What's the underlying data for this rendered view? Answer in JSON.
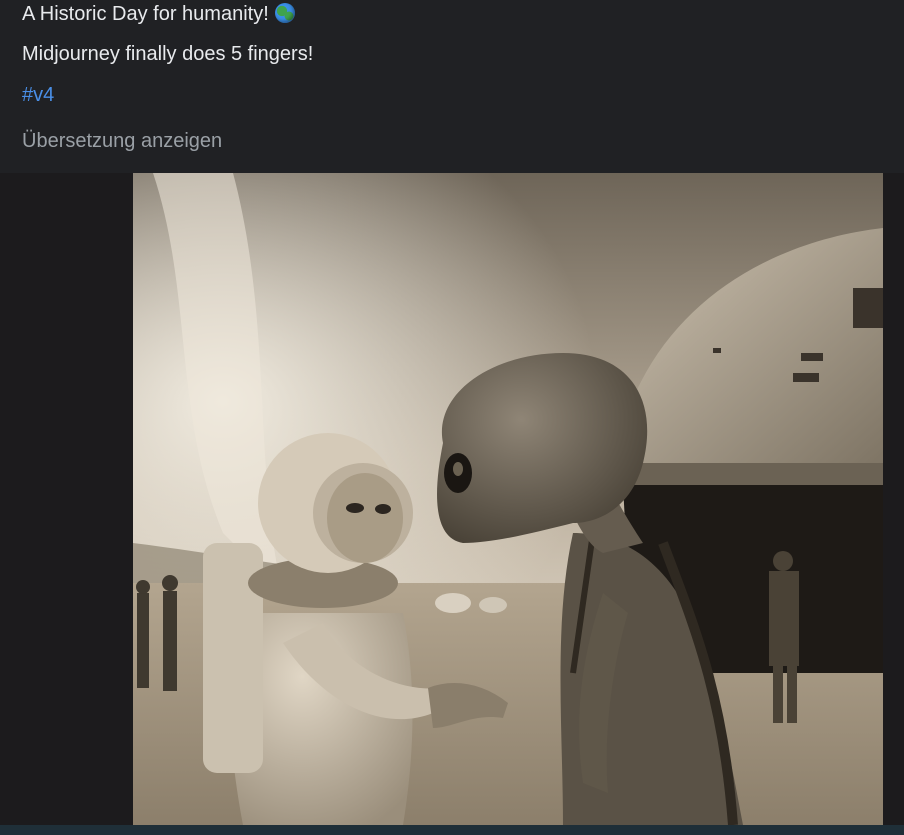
{
  "post": {
    "line1": "A Historic Day for humanity!",
    "line1_emoji": "globe-emoji",
    "line2": "Midjourney finally does 5 fingers!",
    "hashtag": "#v4",
    "translate_link": "Übersetzung anzeigen"
  },
  "media": {
    "image_alt": "Sepia photo of an astronaut shaking hands with an alien in front of a domed spacecraft in a desert",
    "icon": "photo"
  },
  "colors": {
    "background": "#202124",
    "text": "#e8eaed",
    "hashtag": "#4a8fe7",
    "muted": "#9aa0a6"
  }
}
